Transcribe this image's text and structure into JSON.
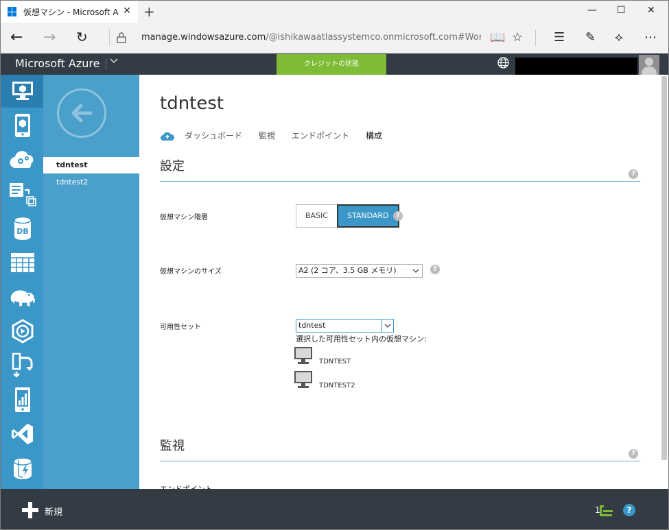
{
  "browser": {
    "tab_title": "仮想マシン - Microsoft A",
    "url_host": "manage.windowsazure.com",
    "url_path": "/@ishikawaatlassystemco.onmicrosoft.com#Workspaces/V"
  },
  "azure": {
    "brand": "Microsoft Azure",
    "credit_label": "クレジットの状態"
  },
  "subnav": {
    "items": [
      {
        "label": "tdntest",
        "selected": true
      },
      {
        "label": "tdntest2",
        "selected": false
      }
    ]
  },
  "main": {
    "title": "tdntest",
    "tabs": [
      "ダッシュボード",
      "監視",
      "エンドポイント",
      "構成"
    ],
    "active_tab": "構成",
    "settings_section": "設定",
    "tier_label": "仮想マシン階層",
    "tier_options": [
      "BASIC",
      "STANDARD"
    ],
    "tier_selected": "STANDARD",
    "size_label": "仮想マシンのサイズ",
    "size_value": "A2 (2 コア、3.5 GB メモリ)",
    "avset_label": "可用性セット",
    "avset_value": "tdntest",
    "avset_vms_caption": "選択した可用性セット内の仮想マシン:",
    "avset_vms": [
      "TDNTEST",
      "TDNTEST2"
    ],
    "monitor_section": "監視",
    "cut_text": "エンドポイント"
  },
  "bottom": {
    "new_label": "新規",
    "count": "1",
    "help": "?"
  },
  "help_glyph": "?",
  "colors": {
    "azure_blue": "#3a97c8",
    "header_dark": "#333b44",
    "credit_green": "#7ebc36"
  }
}
